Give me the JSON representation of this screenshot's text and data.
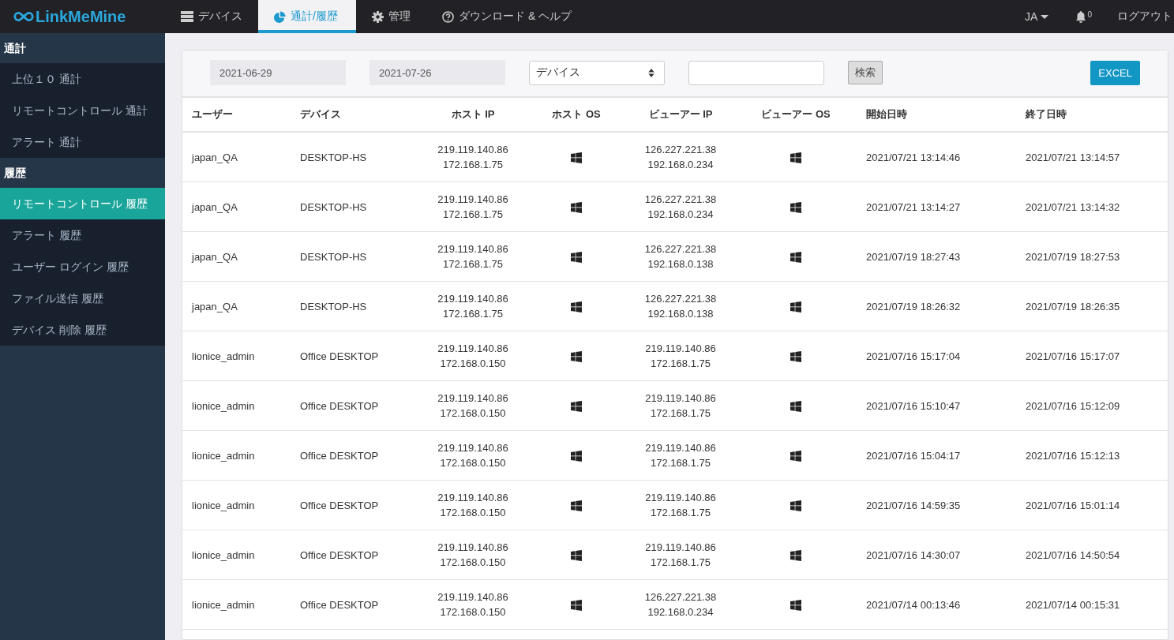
{
  "logo": {
    "text": "LinkMeMine"
  },
  "nav_tabs": [
    {
      "label": "デバイス",
      "selected": false
    },
    {
      "label": "通計/履歴",
      "selected": true
    },
    {
      "label": "管理",
      "selected": false
    },
    {
      "label": "ダウンロード & ヘルプ",
      "selected": false
    }
  ],
  "top_right": {
    "language": "JA",
    "notification_count": "0",
    "logout": "ログアウト"
  },
  "sidebar": [
    {
      "heading": "通計",
      "items": [
        {
          "label": "上位１０ 通計",
          "selected": false
        },
        {
          "label": "リモートコントロール 通計",
          "selected": false
        },
        {
          "label": "アラート 通計",
          "selected": false
        }
      ]
    },
    {
      "heading": "履歴",
      "items": [
        {
          "label": "リモートコントロール 履歴",
          "selected": true
        },
        {
          "label": "アラート 履歴",
          "selected": false
        },
        {
          "label": "ユーザー ログイン 履歴",
          "selected": false
        },
        {
          "label": "ファイル送信 履歴",
          "selected": false
        },
        {
          "label": "デバイス 削除 履歴",
          "selected": false
        }
      ]
    }
  ],
  "filters": {
    "start_date": "2021-06-29",
    "end_date": "2021-07-26",
    "select_value": "デバイス",
    "search_button": "検索",
    "excel_button": "EXCEL"
  },
  "table": {
    "columns": [
      "ユーザー",
      "デバイス",
      "ホスト IP",
      "ホスト OS",
      "ビューアー IP",
      "ビューアー OS",
      "開始日時",
      "終了日時"
    ],
    "rows": [
      {
        "user": "japan_QA",
        "device": "DESKTOP-HS",
        "host_ip": [
          "219.119.140.86",
          "172.168.1.75"
        ],
        "viewer_ip": [
          "126.227.221.38",
          "192.168.0.234"
        ],
        "start": "2021/07/21 13:14:46",
        "end": "2021/07/21 13:14:57"
      },
      {
        "user": "japan_QA",
        "device": "DESKTOP-HS",
        "host_ip": [
          "219.119.140.86",
          "172.168.1.75"
        ],
        "viewer_ip": [
          "126.227.221.38",
          "192.168.0.234"
        ],
        "start": "2021/07/21 13:14:27",
        "end": "2021/07/21 13:14:32"
      },
      {
        "user": "japan_QA",
        "device": "DESKTOP-HS",
        "host_ip": [
          "219.119.140.86",
          "172.168.1.75"
        ],
        "viewer_ip": [
          "126.227.221.38",
          "192.168.0.138"
        ],
        "start": "2021/07/19 18:27:43",
        "end": "2021/07/19 18:27:53"
      },
      {
        "user": "japan_QA",
        "device": "DESKTOP-HS",
        "host_ip": [
          "219.119.140.86",
          "172.168.1.75"
        ],
        "viewer_ip": [
          "126.227.221.38",
          "192.168.0.138"
        ],
        "start": "2021/07/19 18:26:32",
        "end": "2021/07/19 18:26:35"
      },
      {
        "user": "lionice_admin",
        "device": "Office DESKTOP",
        "host_ip": [
          "219.119.140.86",
          "172.168.0.150"
        ],
        "viewer_ip": [
          "219.119.140.86",
          "172.168.1.75"
        ],
        "start": "2021/07/16 15:17:04",
        "end": "2021/07/16 15:17:07"
      },
      {
        "user": "lionice_admin",
        "device": "Office DESKTOP",
        "host_ip": [
          "219.119.140.86",
          "172.168.0.150"
        ],
        "viewer_ip": [
          "219.119.140.86",
          "172.168.1.75"
        ],
        "start": "2021/07/16 15:10:47",
        "end": "2021/07/16 15:12:09"
      },
      {
        "user": "lionice_admin",
        "device": "Office DESKTOP",
        "host_ip": [
          "219.119.140.86",
          "172.168.0.150"
        ],
        "viewer_ip": [
          "219.119.140.86",
          "172.168.1.75"
        ],
        "start": "2021/07/16 15:04:17",
        "end": "2021/07/16 15:12:13"
      },
      {
        "user": "lionice_admin",
        "device": "Office DESKTOP",
        "host_ip": [
          "219.119.140.86",
          "172.168.0.150"
        ],
        "viewer_ip": [
          "219.119.140.86",
          "172.168.1.75"
        ],
        "start": "2021/07/16 14:59:35",
        "end": "2021/07/16 15:01:14"
      },
      {
        "user": "lionice_admin",
        "device": "Office DESKTOP",
        "host_ip": [
          "219.119.140.86",
          "172.168.0.150"
        ],
        "viewer_ip": [
          "219.119.140.86",
          "172.168.1.75"
        ],
        "start": "2021/07/16 14:30:07",
        "end": "2021/07/16 14:50:54"
      },
      {
        "user": "lionice_admin",
        "device": "Office DESKTOP",
        "host_ip": [
          "219.119.140.86",
          "172.168.0.150"
        ],
        "viewer_ip": [
          "126.227.221.38",
          "192.168.0.234"
        ],
        "start": "2021/07/14 00:13:46",
        "end": "2021/07/14 00:15:31"
      }
    ]
  }
}
